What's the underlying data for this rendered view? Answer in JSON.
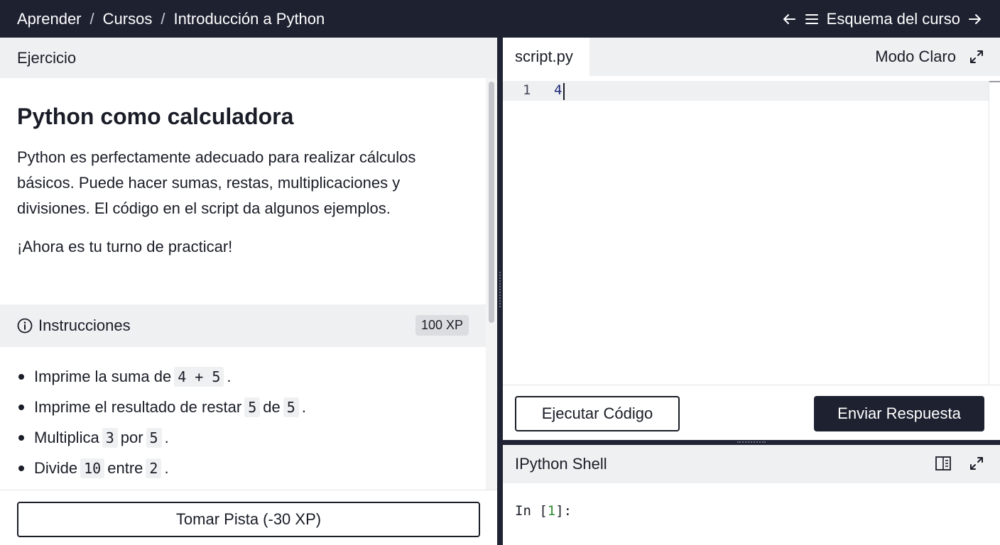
{
  "header": {
    "breadcrumbs": [
      "Aprender",
      "Cursos",
      "Introducción a Python"
    ],
    "separator": "/",
    "outline_label": "Esquema del curso",
    "icons": [
      "arrow-left-icon",
      "menu-icon",
      "arrow-right-icon"
    ]
  },
  "exercise": {
    "panel_title": "Ejercicio",
    "title": "Python como calculadora",
    "description": "Python es perfectamente adecuado para realizar cálculos básicos. Puede hacer sumas, restas, multiplicaciones y divisiones. El código en el script da algunos ejemplos.",
    "call_to_action": "¡Ahora es tu turno de practicar!"
  },
  "instructions": {
    "label": "Instrucciones",
    "xp": "100 XP",
    "steps": [
      {
        "a": "Imprime la suma de",
        "c1": "4 + 5",
        "b": "",
        "c2": "",
        "end": "."
      },
      {
        "a": "Imprime el resultado de restar",
        "c1": "5",
        "b": "de",
        "c2": "5",
        "end": "."
      },
      {
        "a": "Multiplica",
        "c1": "3",
        "b": "por",
        "c2": "5",
        "end": "."
      },
      {
        "a": "Divide",
        "c1": "10",
        "b": "entre",
        "c2": "2",
        "end": "."
      }
    ]
  },
  "hint_button": "Tomar Pista (-30 XP)",
  "editor": {
    "tab": "script.py",
    "mode": "Modo Claro",
    "line_number": "1",
    "code": "4"
  },
  "actions": {
    "run": "Ejecutar Código",
    "submit": "Enviar Respuesta"
  },
  "shell": {
    "title": "IPython Shell",
    "prompt_prefix": "In [",
    "prompt_number": "1",
    "prompt_suffix": "]:"
  },
  "colors": {
    "topbar": "#1d2130",
    "panel_header": "#eff0f2",
    "primary_button": "#1d2130"
  }
}
